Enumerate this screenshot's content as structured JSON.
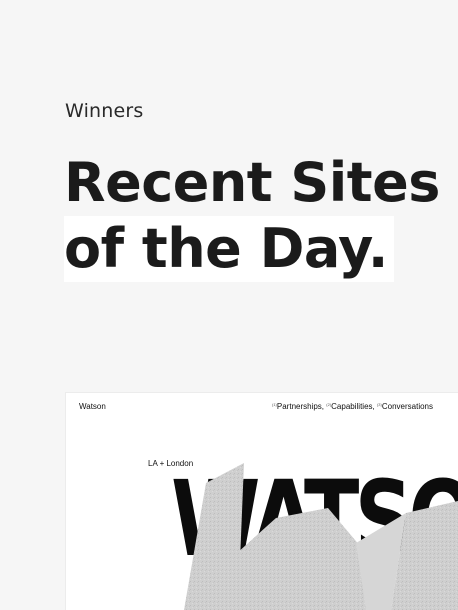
{
  "section": {
    "eyebrow": "Winners",
    "headline_line1": "Recent Sites",
    "headline_line2": "of the Day."
  },
  "preview": {
    "logo": "Watson",
    "nav": {
      "item1_num": "(1)",
      "item1": "Partnerships,",
      "item2_num": "(2)",
      "item2": "Capabilities,",
      "item3_num": "(3)",
      "item3": "Conversations"
    },
    "location": "LA + London",
    "wordmark": "WATSO"
  }
}
